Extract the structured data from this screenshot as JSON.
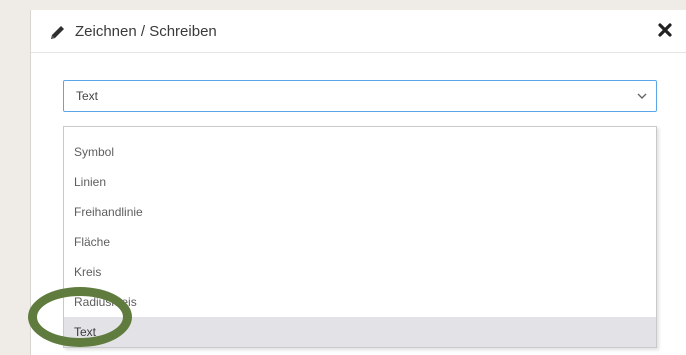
{
  "dialog": {
    "title": "Zeichnen / Schreiben",
    "icon": "pencil-icon",
    "close_icon": "close-icon"
  },
  "select": {
    "value": "Text",
    "icon": "chevron-down-icon"
  },
  "dropdown": {
    "options": [
      {
        "label": "Symbol",
        "selected": false
      },
      {
        "label": "Linien",
        "selected": false
      },
      {
        "label": "Freihandlinie",
        "selected": false
      },
      {
        "label": "Fläche",
        "selected": false
      },
      {
        "label": "Kreis",
        "selected": false
      },
      {
        "label": "Radiuskreis",
        "selected": false
      },
      {
        "label": "Text",
        "selected": true
      }
    ]
  },
  "annotation": {
    "highlight_color": "#5f7c3e"
  },
  "colors": {
    "background": "#efebe6",
    "select_border": "#5aa6e8",
    "selected_option": "#e3e3e7"
  }
}
